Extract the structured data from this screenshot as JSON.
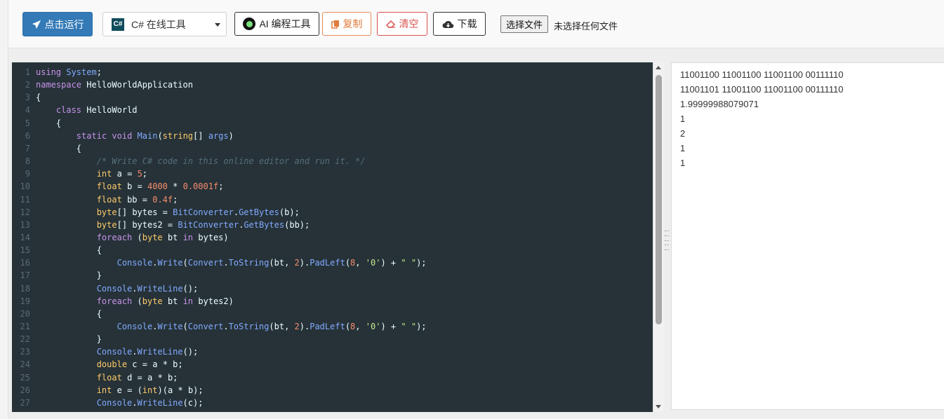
{
  "toolbar": {
    "run_label": "点击运行",
    "language": "C# 在线工具",
    "cs_badge": "C#",
    "ai_label": "AI 编程工具",
    "copy_label": "复制",
    "clear_label": "清空",
    "download_label": "下载",
    "file_button": "选择文件",
    "file_status": "未选择任何文件"
  },
  "editor": {
    "lines": [
      {
        "n": "1",
        "code": "using System;"
      },
      {
        "n": "2",
        "code": "namespace HelloWorldApplication"
      },
      {
        "n": "3",
        "code": "{"
      },
      {
        "n": "4",
        "code": "    class HelloWorld"
      },
      {
        "n": "5",
        "code": "    {"
      },
      {
        "n": "6",
        "code": "        static void Main(string[] args)"
      },
      {
        "n": "7",
        "code": "        {"
      },
      {
        "n": "8",
        "code": "            /* Write C# code in this online editor and run it. */"
      },
      {
        "n": "9",
        "code": "            int a = 5;"
      },
      {
        "n": "10",
        "code": "            float b = 4000 * 0.0001f;"
      },
      {
        "n": "11",
        "code": "            float bb = 0.4f;"
      },
      {
        "n": "12",
        "code": "            byte[] bytes = BitConverter.GetBytes(b);"
      },
      {
        "n": "13",
        "code": "            byte[] bytes2 = BitConverter.GetBytes(bb);"
      },
      {
        "n": "14",
        "code": "            foreach (byte bt in bytes)"
      },
      {
        "n": "15",
        "code": "            {"
      },
      {
        "n": "16",
        "code": "                Console.Write(Convert.ToString(bt, 2).PadLeft(8, '0') + \" \");"
      },
      {
        "n": "17",
        "code": "            }"
      },
      {
        "n": "18",
        "code": "            Console.WriteLine();"
      },
      {
        "n": "19",
        "code": "            foreach (byte bt in bytes2)"
      },
      {
        "n": "20",
        "code": "            {"
      },
      {
        "n": "21",
        "code": "                Console.Write(Convert.ToString(bt, 2).PadLeft(8, '0') + \" \");"
      },
      {
        "n": "22",
        "code": "            }"
      },
      {
        "n": "23",
        "code": "            Console.WriteLine();"
      },
      {
        "n": "24",
        "code": "            double c = a * b;"
      },
      {
        "n": "25",
        "code": "            float d = a * b;"
      },
      {
        "n": "26",
        "code": "            int e = (int)(a * b);"
      },
      {
        "n": "27",
        "code": "            Console.WriteLine(c);"
      }
    ]
  },
  "output": {
    "lines": [
      "11001100 11001100 11001100 00111110",
      "11001101 11001100 11001100 00111110",
      "1.99999988079071",
      "1",
      "2",
      "1",
      "1"
    ]
  }
}
